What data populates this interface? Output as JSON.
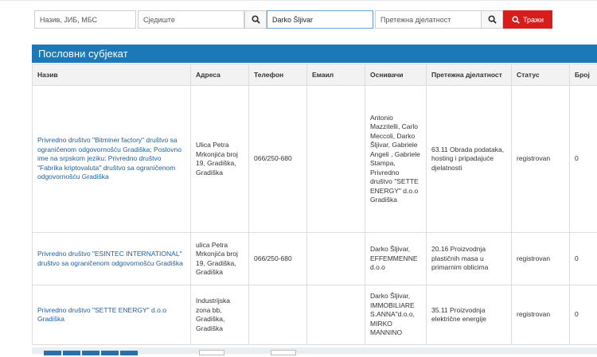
{
  "search": {
    "name_placeholder": "Назив, ЈИБ, МБС",
    "seat_placeholder": "Сједиште",
    "founder_value": "Darko Šljivar",
    "activity_placeholder": "Претежна дјелатност",
    "search_button": "Тражи",
    "accent_color": "#d81c1c"
  },
  "panel": {
    "title": "Пословни субјекат",
    "color": "#1d78b8"
  },
  "table": {
    "headers": [
      "Назив",
      "Адреса",
      "Телефон",
      "Емаил",
      "Оснивачи",
      "Претежна дјелатност",
      "Статус",
      "Број"
    ],
    "rows": [
      {
        "name": "Privredno društvo \"Bitminer factory\" društvo sa ograničenom odgovornošću Gradiška; Poslovno ime na srpskom jeziku: Privredno društvo \"Fabrika kriptovaluta\" društvo sa ograničenom odgovornošću Gradiška",
        "address": "Ulica Petra Mrkonjića broj 19, Gradiška, Gradiška",
        "phone": "066/250-680",
        "email": "",
        "founders": "Antonio Mazzitelli, Carlo Meccoli, Darko Šljivar, Gabriele Angeli , Gabriele Stampa, Privredno društvo \"SETTE ENERGY\" d.o.o Gradiška",
        "activity": "63.11 Obrada podataka, hosting i pripadajuće djelatnosti",
        "status": "registrovan",
        "number": "0"
      },
      {
        "name": "Privredno društvo \"ESINTEC INTERNATIONAL\" društvo sa ograničenom odgovornošću Gradiška",
        "address": "ulica Petra Mrkonjića broj 19, Gradiška, Gradiška",
        "phone": "066/250-680",
        "email": "",
        "founders": "Darko Šljivar, EFFEMMENNE d.o.o",
        "activity": "20.16 Proizvodnja plastičnih masa u primarnim oblicima",
        "status": "registrovan",
        "number": "0"
      },
      {
        "name": "Privredno društvo \"SETTE ENERGY\" d.o.o Gradiška",
        "address": "Industrijska zona bb, Gradiška, Gradiška",
        "phone": "",
        "email": "",
        "founders": "Darko Šljivar, IMMOBILIARE S.ANNA\"d.o.o, MIRKO MANNINO",
        "activity": "35.11 Proizvodnja električne energije",
        "status": "registrovan",
        "number": "0"
      }
    ]
  },
  "icons": {
    "search": "search-icon"
  }
}
